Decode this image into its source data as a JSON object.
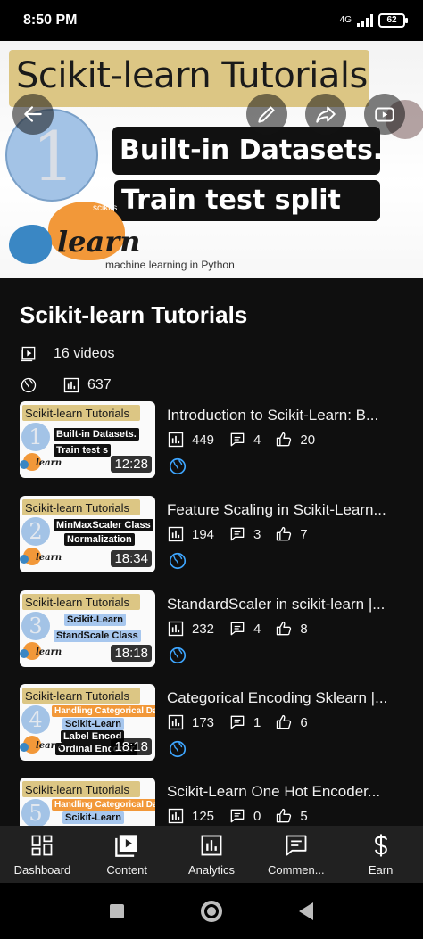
{
  "status_bar": {
    "time": "8:50 PM",
    "network": "4G",
    "battery": "62"
  },
  "hero": {
    "title": "Scikit-learn Tutorials",
    "number": "1",
    "line1": "Built-in Datasets.",
    "line2": "Train test split",
    "logo_top": "scikits",
    "logo_word": "learn",
    "caption": "machine learning in Python",
    "icons": [
      "arrow-back-icon",
      "pencil-icon",
      "share-icon",
      "youtube-play-icon"
    ]
  },
  "playlist": {
    "title": "Scikit-learn Tutorials",
    "video_count": "16 videos",
    "views": "637"
  },
  "videos": [
    {
      "title": "Introduction to Scikit-Learn: B...",
      "duration": "12:28",
      "views": "449",
      "comments": "4",
      "likes": "20",
      "thumb_number": "1",
      "thumb_band": "Scikit-learn Tutorials",
      "chips": [
        "Built-in Datasets.",
        "Train test s"
      ]
    },
    {
      "title": "Feature Scaling in Scikit-Learn...",
      "duration": "18:34",
      "views": "194",
      "comments": "3",
      "likes": "7",
      "thumb_number": "2",
      "thumb_band": "Scikit-learn Tutorials",
      "chips": [
        "MinMaxScaler Class",
        "Normalization"
      ]
    },
    {
      "title": "StandardScaler in scikit-learn |...",
      "duration": "18:18",
      "views": "232",
      "comments": "4",
      "likes": "8",
      "thumb_number": "3",
      "thumb_band": "Scikit-learn Tutorials",
      "chips": [
        "Scikit-Learn",
        "StandScale Class"
      ]
    },
    {
      "title": "Categorical Encoding Sklearn |...",
      "duration": "18:18",
      "views": "173",
      "comments": "1",
      "likes": "6",
      "thumb_number": "4",
      "thumb_band": "Scikit-learn Tutorials",
      "chips": [
        "Handling Categorical Data",
        "Scikit-Learn",
        "Label Encod",
        "Ordinal Encoder"
      ]
    },
    {
      "title": "Scikit-Learn One Hot Encoder...",
      "duration": "",
      "views": "125",
      "comments": "0",
      "likes": "5",
      "thumb_number": "5",
      "thumb_band": "Scikit-learn Tutorials",
      "chips": [
        "Handling Categorical Data",
        "Scikit-Learn"
      ]
    }
  ],
  "bottom_nav": [
    {
      "label": "Dashboard",
      "icon": "dashboard-icon"
    },
    {
      "label": "Content",
      "icon": "content-icon"
    },
    {
      "label": "Analytics",
      "icon": "analytics-icon"
    },
    {
      "label": "Commen...",
      "icon": "comments-icon"
    },
    {
      "label": "Earn",
      "icon": "earn-dollar-icon"
    }
  ],
  "colors": {
    "background": "#0f0f0f",
    "nav_background": "#212121",
    "globe_blue": "#3ea6ff",
    "title_band": "#dcc684"
  }
}
